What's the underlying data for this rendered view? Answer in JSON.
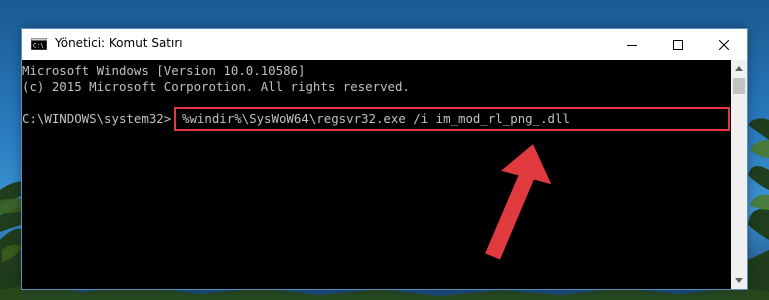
{
  "window": {
    "title": "Yönetici: Komut Satırı",
    "icon": "cmd-icon"
  },
  "controls": {
    "minimize_icon": "minimize-icon",
    "maximize_icon": "maximize-icon",
    "close_icon": "close-icon"
  },
  "console": {
    "line1": "Microsoft Windows [Version 10.0.10586]",
    "line2": "(c) 2015 Microsoft Corporotion. All rights reserved.",
    "prompt": "C:\\WINDOWS\\system32>",
    "command": "%windir%\\SysWoW64\\regsvr32.exe /i im_mod_rl_png_.dll"
  },
  "annotation": {
    "highlight_color": "#e0393e",
    "arrow_icon": "red-arrow-icon"
  },
  "scrollbar": {
    "up_icon": "scroll-up-arrow-icon",
    "down_icon": "scroll-down-arrow-icon"
  }
}
